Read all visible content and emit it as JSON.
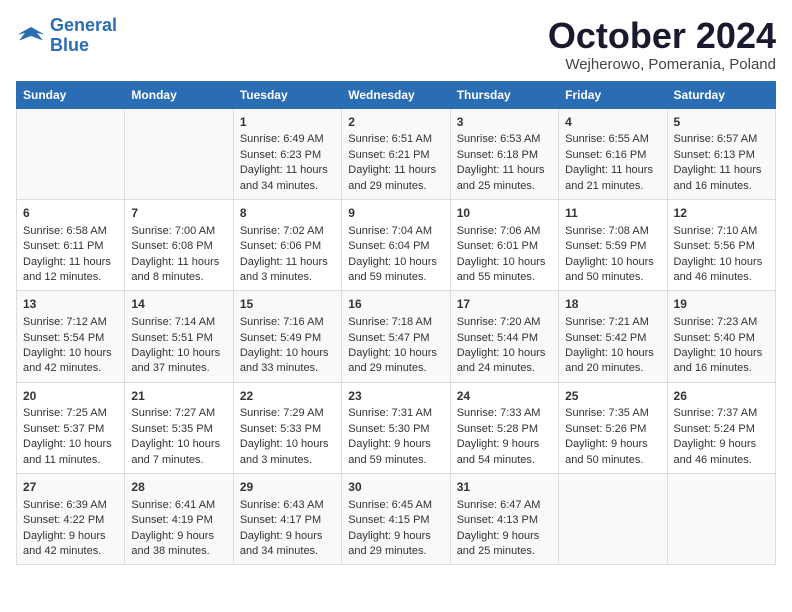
{
  "header": {
    "logo_line1": "General",
    "logo_line2": "Blue",
    "month": "October 2024",
    "location": "Wejherowo, Pomerania, Poland"
  },
  "days_of_week": [
    "Sunday",
    "Monday",
    "Tuesday",
    "Wednesday",
    "Thursday",
    "Friday",
    "Saturday"
  ],
  "weeks": [
    [
      {
        "day": "",
        "content": ""
      },
      {
        "day": "",
        "content": ""
      },
      {
        "day": "1",
        "content": "Sunrise: 6:49 AM\nSunset: 6:23 PM\nDaylight: 11 hours\nand 34 minutes."
      },
      {
        "day": "2",
        "content": "Sunrise: 6:51 AM\nSunset: 6:21 PM\nDaylight: 11 hours\nand 29 minutes."
      },
      {
        "day": "3",
        "content": "Sunrise: 6:53 AM\nSunset: 6:18 PM\nDaylight: 11 hours\nand 25 minutes."
      },
      {
        "day": "4",
        "content": "Sunrise: 6:55 AM\nSunset: 6:16 PM\nDaylight: 11 hours\nand 21 minutes."
      },
      {
        "day": "5",
        "content": "Sunrise: 6:57 AM\nSunset: 6:13 PM\nDaylight: 11 hours\nand 16 minutes."
      }
    ],
    [
      {
        "day": "6",
        "content": "Sunrise: 6:58 AM\nSunset: 6:11 PM\nDaylight: 11 hours\nand 12 minutes."
      },
      {
        "day": "7",
        "content": "Sunrise: 7:00 AM\nSunset: 6:08 PM\nDaylight: 11 hours\nand 8 minutes."
      },
      {
        "day": "8",
        "content": "Sunrise: 7:02 AM\nSunset: 6:06 PM\nDaylight: 11 hours\nand 3 minutes."
      },
      {
        "day": "9",
        "content": "Sunrise: 7:04 AM\nSunset: 6:04 PM\nDaylight: 10 hours\nand 59 minutes."
      },
      {
        "day": "10",
        "content": "Sunrise: 7:06 AM\nSunset: 6:01 PM\nDaylight: 10 hours\nand 55 minutes."
      },
      {
        "day": "11",
        "content": "Sunrise: 7:08 AM\nSunset: 5:59 PM\nDaylight: 10 hours\nand 50 minutes."
      },
      {
        "day": "12",
        "content": "Sunrise: 7:10 AM\nSunset: 5:56 PM\nDaylight: 10 hours\nand 46 minutes."
      }
    ],
    [
      {
        "day": "13",
        "content": "Sunrise: 7:12 AM\nSunset: 5:54 PM\nDaylight: 10 hours\nand 42 minutes."
      },
      {
        "day": "14",
        "content": "Sunrise: 7:14 AM\nSunset: 5:51 PM\nDaylight: 10 hours\nand 37 minutes."
      },
      {
        "day": "15",
        "content": "Sunrise: 7:16 AM\nSunset: 5:49 PM\nDaylight: 10 hours\nand 33 minutes."
      },
      {
        "day": "16",
        "content": "Sunrise: 7:18 AM\nSunset: 5:47 PM\nDaylight: 10 hours\nand 29 minutes."
      },
      {
        "day": "17",
        "content": "Sunrise: 7:20 AM\nSunset: 5:44 PM\nDaylight: 10 hours\nand 24 minutes."
      },
      {
        "day": "18",
        "content": "Sunrise: 7:21 AM\nSunset: 5:42 PM\nDaylight: 10 hours\nand 20 minutes."
      },
      {
        "day": "19",
        "content": "Sunrise: 7:23 AM\nSunset: 5:40 PM\nDaylight: 10 hours\nand 16 minutes."
      }
    ],
    [
      {
        "day": "20",
        "content": "Sunrise: 7:25 AM\nSunset: 5:37 PM\nDaylight: 10 hours\nand 11 minutes."
      },
      {
        "day": "21",
        "content": "Sunrise: 7:27 AM\nSunset: 5:35 PM\nDaylight: 10 hours\nand 7 minutes."
      },
      {
        "day": "22",
        "content": "Sunrise: 7:29 AM\nSunset: 5:33 PM\nDaylight: 10 hours\nand 3 minutes."
      },
      {
        "day": "23",
        "content": "Sunrise: 7:31 AM\nSunset: 5:30 PM\nDaylight: 9 hours\nand 59 minutes."
      },
      {
        "day": "24",
        "content": "Sunrise: 7:33 AM\nSunset: 5:28 PM\nDaylight: 9 hours\nand 54 minutes."
      },
      {
        "day": "25",
        "content": "Sunrise: 7:35 AM\nSunset: 5:26 PM\nDaylight: 9 hours\nand 50 minutes."
      },
      {
        "day": "26",
        "content": "Sunrise: 7:37 AM\nSunset: 5:24 PM\nDaylight: 9 hours\nand 46 minutes."
      }
    ],
    [
      {
        "day": "27",
        "content": "Sunrise: 6:39 AM\nSunset: 4:22 PM\nDaylight: 9 hours\nand 42 minutes."
      },
      {
        "day": "28",
        "content": "Sunrise: 6:41 AM\nSunset: 4:19 PM\nDaylight: 9 hours\nand 38 minutes."
      },
      {
        "day": "29",
        "content": "Sunrise: 6:43 AM\nSunset: 4:17 PM\nDaylight: 9 hours\nand 34 minutes."
      },
      {
        "day": "30",
        "content": "Sunrise: 6:45 AM\nSunset: 4:15 PM\nDaylight: 9 hours\nand 29 minutes."
      },
      {
        "day": "31",
        "content": "Sunrise: 6:47 AM\nSunset: 4:13 PM\nDaylight: 9 hours\nand 25 minutes."
      },
      {
        "day": "",
        "content": ""
      },
      {
        "day": "",
        "content": ""
      }
    ]
  ]
}
